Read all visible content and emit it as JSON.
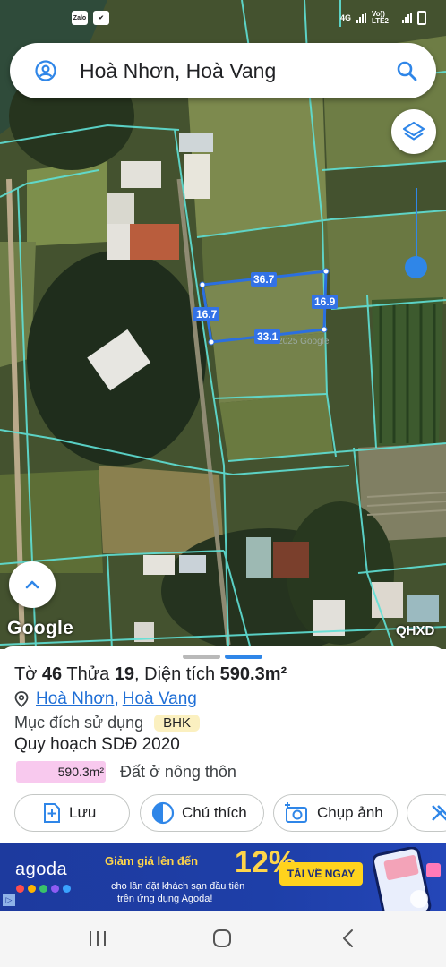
{
  "status_bar": {
    "app_chip": "Zalo",
    "network": "4G",
    "lte_label": "Vo)) LTE2"
  },
  "search": {
    "title": "Hoà Nhơn, Hoà Vang"
  },
  "map": {
    "dimensions": {
      "top": "36.7",
      "right": "16.9",
      "left": "16.7",
      "bottom": "33.1"
    },
    "watermark": "Google",
    "qhxd_label": "QHXD"
  },
  "sheet": {
    "parcel": {
      "sheet_label": "Tờ",
      "sheet_no": "46",
      "plot_label": "Thửa",
      "plot_no": "19",
      "area_label": "Diện tích",
      "area_value": "590.3m²"
    },
    "location": {
      "ward": "Hoà Nhơn",
      "separator": ",",
      "district": "Hoà Vang"
    },
    "purpose": {
      "label": "Mục đích sử dụng",
      "code": "BHK"
    },
    "plan_title": "Quy hoạch SDĐ 2020",
    "plan_area": {
      "value": "590.3m²",
      "description": "Đất ở nông thôn"
    },
    "actions": [
      {
        "label": "Lưu",
        "icon": "add-bookmark-icon"
      },
      {
        "label": "Chú thích",
        "icon": "contrast-icon"
      },
      {
        "label": "Chụp ảnh",
        "icon": "add-photo-icon"
      }
    ]
  },
  "ad": {
    "brand": "agoda",
    "headline": "Giảm giá lên đến",
    "percent": "12%",
    "line1": "cho lần đặt khách sạn đầu tiên",
    "line2": "trên ứng dụng Agoda!",
    "cta": "TẢI VỀ NGAY",
    "colors": {
      "background": "#1d3a9e",
      "accent": "#ffd31d"
    }
  },
  "navbar": {
    "icons": [
      "recent-apps-icon",
      "home-icon",
      "back-icon"
    ]
  },
  "colors": {
    "accent": "#2f86e8",
    "link": "#1f6fd6",
    "parcel_outline": "#2b6fe0",
    "area_chip": "#f8c9ee",
    "badge": "#fbf0c0"
  }
}
